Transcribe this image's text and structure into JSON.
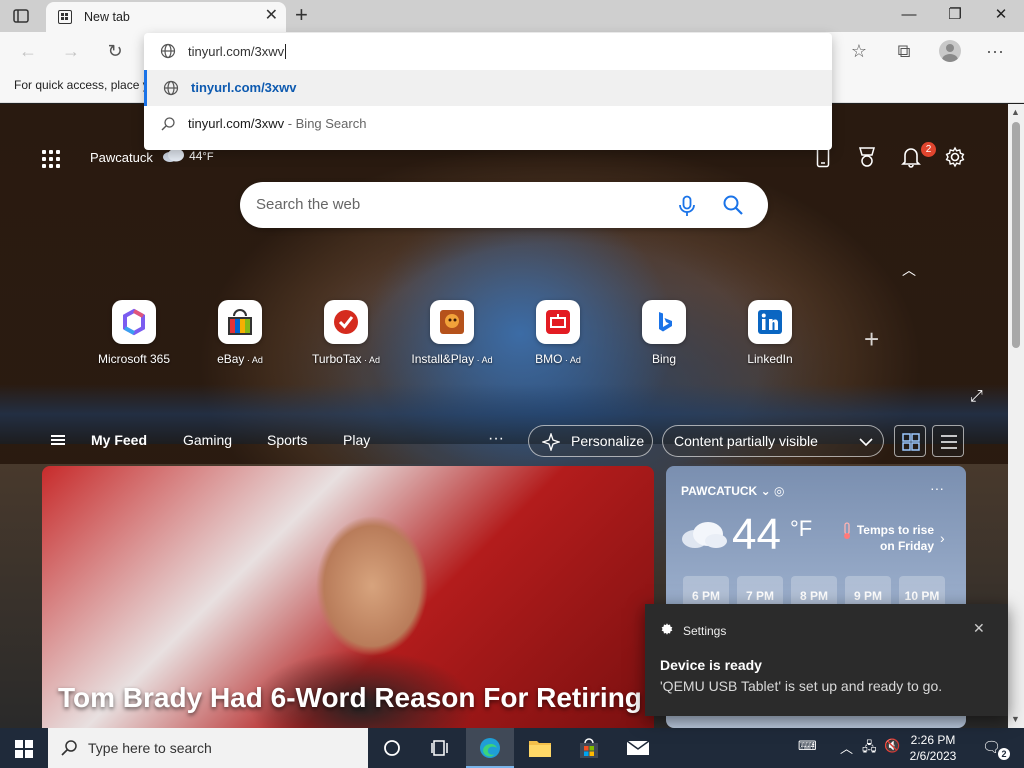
{
  "browser": {
    "tab_title": "New tab",
    "address_text": "tinyurl.com/3xwv",
    "favorites_message": "For quick access, place y"
  },
  "omnibox": {
    "suggestions": [
      {
        "main": "tinyurl.com/3xwv",
        "sub": "",
        "icon": "globe-icon",
        "selected": true
      },
      {
        "main": "tinyurl.com/3xwv",
        "sub": " - Bing Search",
        "icon": "search-icon",
        "selected": false
      }
    ]
  },
  "ntp": {
    "location": "Pawcatuck",
    "temp_small": "44",
    "temp_unit_small": "°F",
    "notification_count": "2",
    "search_placeholder": "Search the web",
    "tiles": [
      {
        "name": "Microsoft 365",
        "ad": "",
        "icon": "microsoft365-icon",
        "color": "#7b5cf0"
      },
      {
        "name": "eBay",
        "ad": " · Ad",
        "icon": "ebay-icon",
        "color": "#e53238"
      },
      {
        "name": "TurboTax",
        "ad": " · Ad",
        "icon": "turbotax-icon",
        "color": "#d52b1e"
      },
      {
        "name": "Install&Play",
        "ad": " · Ad",
        "icon": "installplay-icon",
        "color": "#b5521b"
      },
      {
        "name": "BMO",
        "ad": " · Ad",
        "icon": "bmo-icon",
        "color": "#e31c23"
      },
      {
        "name": "Bing",
        "ad": "",
        "icon": "bing-icon",
        "color": "#1a73e8"
      },
      {
        "name": "LinkedIn",
        "ad": "",
        "icon": "linkedin-icon",
        "color": "#0a66c2"
      }
    ],
    "feed_tabs": [
      "My Feed",
      "Gaming",
      "Sports",
      "Play"
    ],
    "more": "···",
    "personalize": "Personalize",
    "content_visibility": "Content partially visible",
    "headline": "Tom Brady Had 6-Word Reason For Retiring"
  },
  "weather_card": {
    "place": "PAWCATUCK",
    "temp": "44",
    "unit": "°F",
    "note": "Temps to rise on Friday",
    "hours": [
      "6 PM",
      "7 PM",
      "8 PM",
      "9 PM",
      "10 PM"
    ]
  },
  "toast": {
    "app": "Settings",
    "title": "Device is ready",
    "body": "'QEMU USB Tablet' is set up and ready to go."
  },
  "taskbar": {
    "search_placeholder": "Type here to search",
    "time": "2:26 PM",
    "date": "2/6/2023",
    "notification_count": "2"
  },
  "colors": {
    "accent": "#1a73e8",
    "notification_badge": "#e0452e",
    "taskbar": "#1f2a3a"
  }
}
